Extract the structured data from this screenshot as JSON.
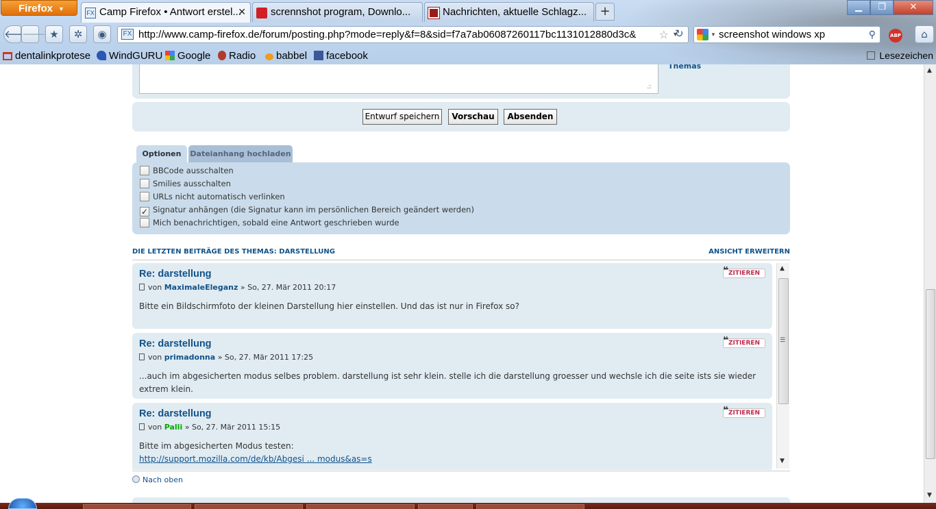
{
  "browser": {
    "menu_button": "Firefox",
    "tabs": [
      {
        "title": "Camp Firefox • Antwort erstel...",
        "active": true
      },
      {
        "title": "scrennshot program, Downlo...",
        "active": false
      },
      {
        "title": "Nachrichten, aktuelle Schlagz...",
        "active": false
      }
    ],
    "new_tab_symbol": "+",
    "url": "http://www.camp-firefox.de/forum/posting.php?mode=reply&f=8&sid=f7a7ab06087260117bc1131012880d3c&",
    "search_text": "screenshot windows xp",
    "bookmarks": [
      "dentalinkprotese",
      "WindGURU",
      "Google",
      "Radio",
      "babbel",
      "facebook"
    ],
    "bookmarks_menu": "Lesezeichen",
    "colors": {
      "firefox_orange": "#e8760f",
      "chrome_blue": "#c9dcf2"
    }
  },
  "page": {
    "partial_link": "Themas",
    "buttons": {
      "draft": "Entwurf speichern",
      "preview": "Vorschau",
      "submit": "Absenden"
    },
    "option_tabs": {
      "options": "Optionen",
      "attachment": "Dateianhang hochladen"
    },
    "options": [
      {
        "label": "BBCode ausschalten",
        "checked": false
      },
      {
        "label": "Smilies ausschalten",
        "checked": false
      },
      {
        "label": "URLs nicht automatisch verlinken",
        "checked": false
      },
      {
        "label": "Signatur anhängen (die Signatur kann im persönlichen Bereich geändert werden)",
        "checked": true
      },
      {
        "label": "Mich benachrichtigen, sobald eine Antwort geschrieben wurde",
        "checked": false
      }
    ],
    "recent_heading": "DIE LETZTEN BEITRÄGE DES THEMAS: DARSTELLUNG",
    "expand_view": "ANSICHT ERWEITERN",
    "quote_label": "ZITIEREN",
    "by_label": "von",
    "posts": [
      {
        "title": "Re: darstellung",
        "author": "MaximaleEleganz",
        "date": "» So, 27. Mär 2011 20:17",
        "body": "Bitte ein Bildschirmfoto der kleinen Darstellung hier einstellen. Und das ist nur in Firefox so?"
      },
      {
        "title": "Re: darstellung",
        "author": "primadonna",
        "date": "» So, 27. Mär 2011 17:25",
        "body": "...auch im abgesicherten modus selbes problem. darstellung ist sehr klein. stelle ich die darstellung groesser und wechsle ich die seite ists sie wieder extrem klein."
      },
      {
        "title": "Re: darstellung",
        "author": "Palli",
        "date": "» So, 27. Mär 2011 15:15",
        "body": "Bitte im abgesicherten Modus testen:",
        "link": "http://support.mozilla.com/de/kb/Abgesi ... modus&as=s"
      }
    ],
    "back_to_top": "Nach oben",
    "colors": {
      "panel": "#e1ebf2",
      "panel_dark": "#cadceb",
      "link": "#105289",
      "quote": "#bc2a4d",
      "author_green": "#00aa00"
    }
  }
}
